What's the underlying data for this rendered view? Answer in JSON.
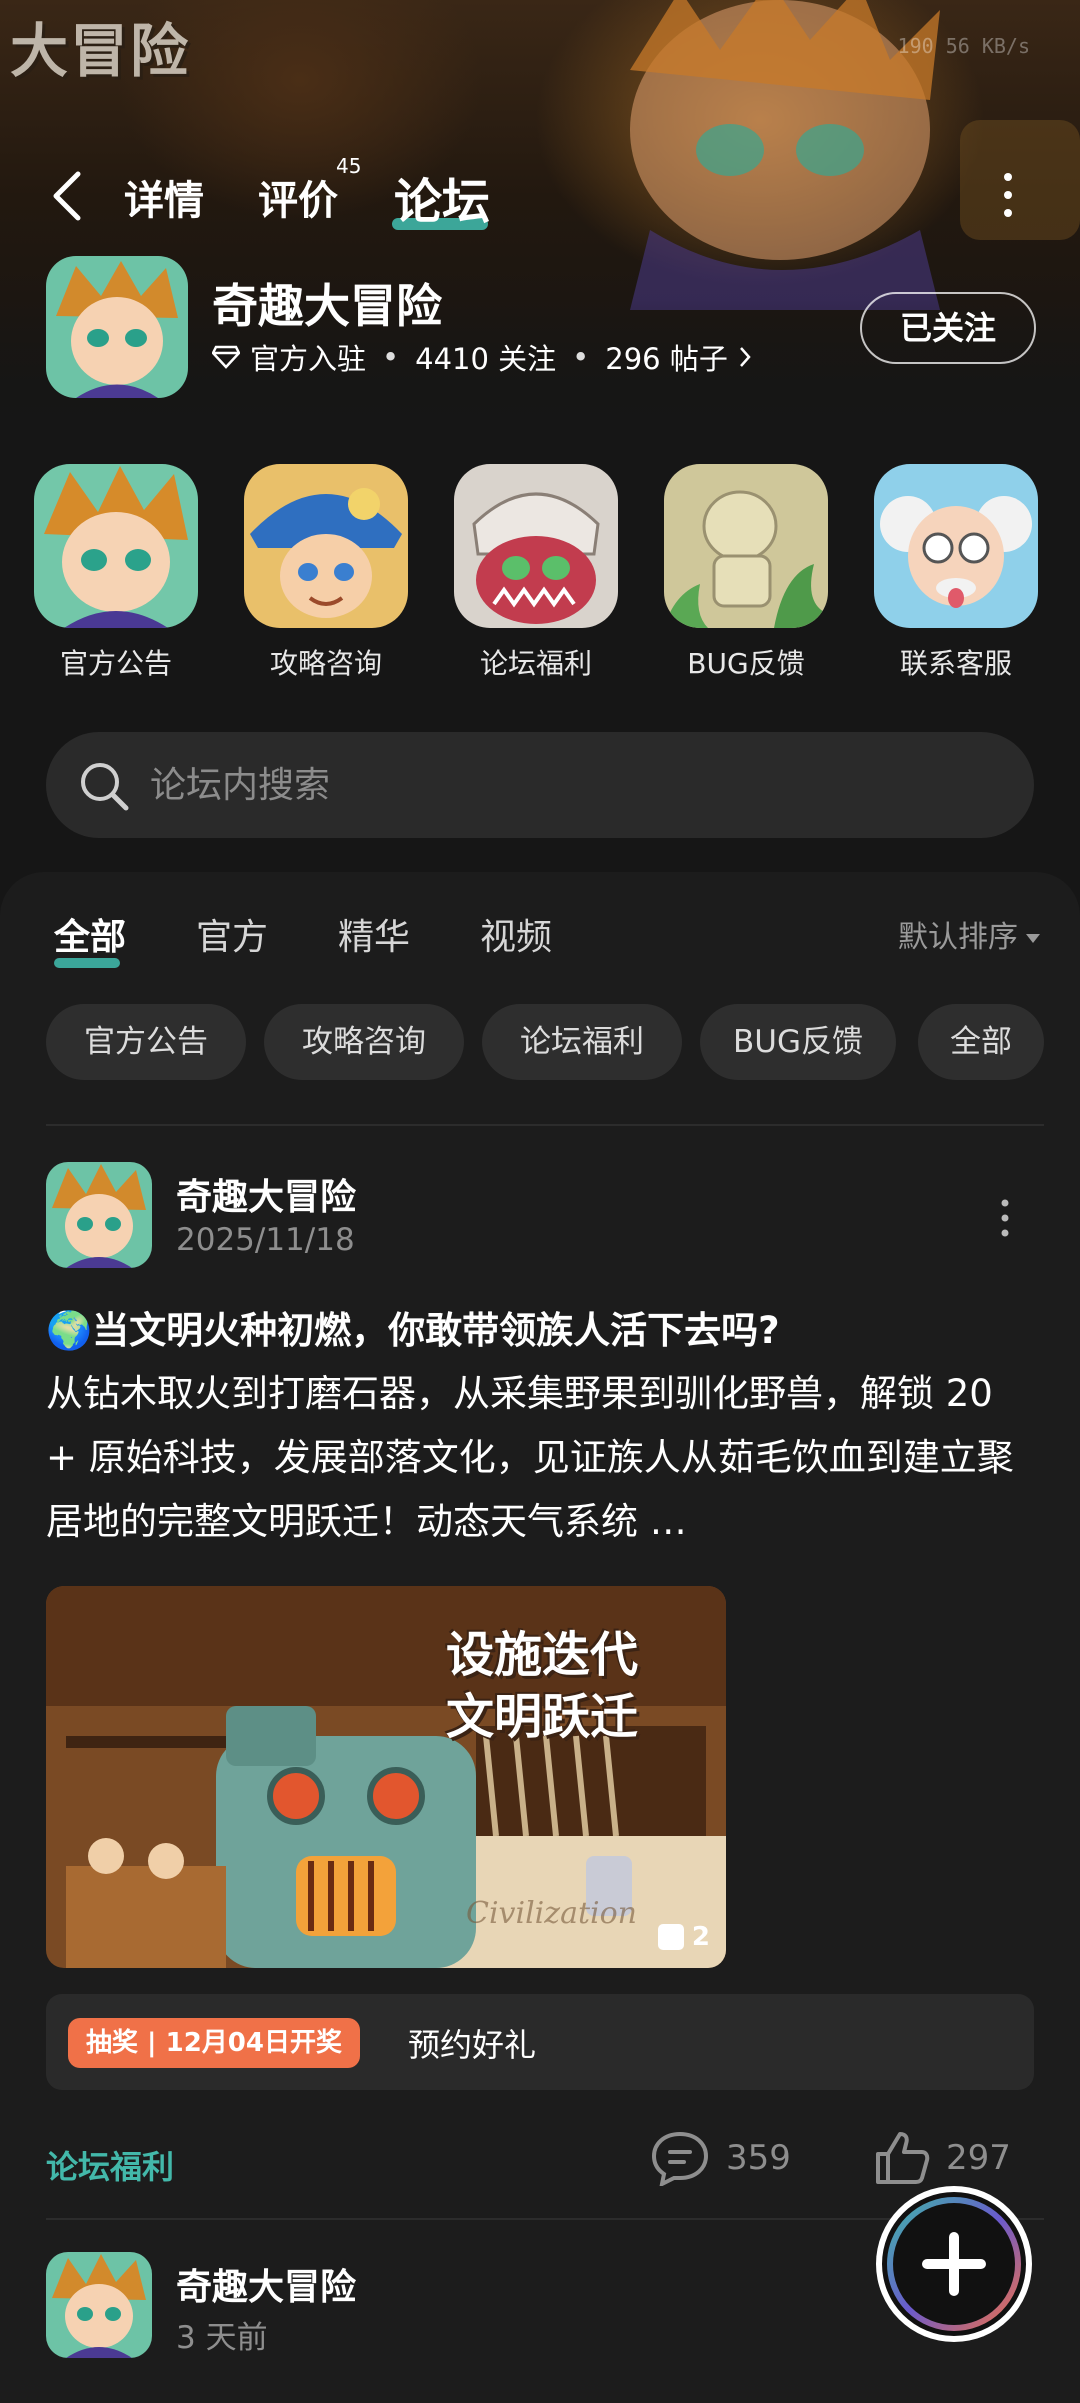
{
  "hero": {
    "logo_text": "大冒险",
    "status_text": "190 56 KB/s"
  },
  "nav": {
    "tabs": [
      {
        "label": "详情"
      },
      {
        "label": "评价",
        "count": "45"
      },
      {
        "label": "论坛"
      }
    ],
    "active_tab": "论坛"
  },
  "game": {
    "name": "奇趣大冒险",
    "official_label": "官方入驻",
    "followers": "4410 关注",
    "posts": "296 帖子",
    "follow_button": "已关注"
  },
  "quick_links": [
    {
      "label": "官方公告",
      "icon": "hero-boy-icon"
    },
    {
      "label": "攻略咨询",
      "icon": "captain-icon"
    },
    {
      "label": "论坛福利",
      "icon": "dinosaur-icon"
    },
    {
      "label": "BUG反馈",
      "icon": "statue-icon"
    },
    {
      "label": "联系客服",
      "icon": "scientist-icon"
    }
  ],
  "search": {
    "placeholder": "论坛内搜索"
  },
  "feed": {
    "tabs": [
      "全部",
      "官方",
      "精华",
      "视频"
    ],
    "active_tab": "全部",
    "sort_label": "默认排序",
    "chips": [
      "官方公告",
      "攻略咨询",
      "论坛福利",
      "BUG反馈",
      "全部"
    ]
  },
  "posts": [
    {
      "author": "奇趣大冒险",
      "date": "2025/11/18",
      "title": "🌍当文明火种初燃，你敢带领族人活下去吗?",
      "body": "从钻木取火到打磨石器，从采集野果到驯化野兽，解锁 20 + 原始科技，发展部落文化，见证族人从茹毛饮血到建立聚居地的完整文明跃迁！动态天气系统 …",
      "image_caption_line1": "设施迭代",
      "image_caption_line2": "文明跃迁",
      "image_watermark": "Civilization",
      "image_count": "2",
      "lottery_badge": "抽奖 | 12月04日开奖",
      "lottery_text": "预约好礼",
      "category": "论坛福利",
      "comments": "359",
      "likes": "297"
    },
    {
      "author": "奇趣大冒险",
      "date": "3 天前"
    }
  ],
  "colors": {
    "accent": "#3fb6a8",
    "lottery": "#f07148",
    "background": "#161616",
    "card": "#1c1c1c"
  }
}
